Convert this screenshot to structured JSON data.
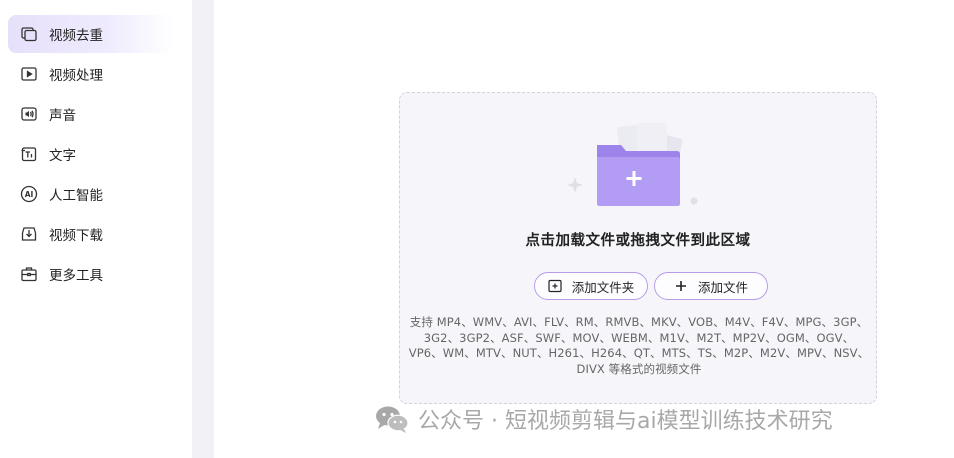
{
  "sidebar": {
    "items": [
      {
        "label": "视频去重",
        "icon": "video-dedup-icon",
        "active": true
      },
      {
        "label": "视频处理",
        "icon": "video-play-icon",
        "active": false
      },
      {
        "label": "声音",
        "icon": "audio-icon",
        "active": false
      },
      {
        "label": "文字",
        "icon": "text-icon",
        "active": false
      },
      {
        "label": "人工智能",
        "icon": "ai-icon",
        "active": false
      },
      {
        "label": "视频下载",
        "icon": "download-icon",
        "active": false
      },
      {
        "label": "更多工具",
        "icon": "toolbox-icon",
        "active": false
      }
    ]
  },
  "dropzone": {
    "title": "点击加载文件或拖拽文件到此区域",
    "add_folder_label": "添加文件夹",
    "add_file_label": "添加文件",
    "formats_text": "支持 MP4、WMV、AVI、FLV、RM、RMVB、MKV、VOB、M4V、F4V、MPG、3GP、3G2、3GP2、ASF、SWF、MOV、WEBM、M1V、M2T、MP2V、OGM、OGV、VP6、WM、MTV、NUT、H261、H264、QT、MTS、TS、M2P、M2V、MPV、NSV、DIVX 等格式的视频文件"
  },
  "watermark": {
    "text": "公众号 · 短视频剪辑与ai模型训练技术研究"
  },
  "colors": {
    "accent": "#a58cf0",
    "active_bg": "#e6e0fb",
    "button_border": "#b79de8"
  }
}
